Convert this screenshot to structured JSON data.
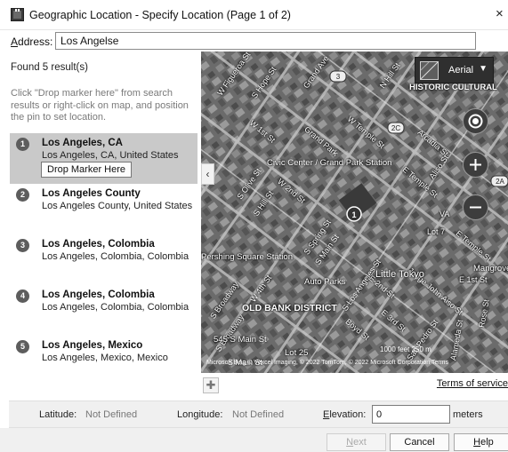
{
  "window": {
    "title": "Geographic Location - Specify Location (Page 1 of 2)",
    "close_label": "×"
  },
  "address": {
    "label_underlined": "A",
    "label_rest": "ddress:",
    "value": "Los Angelse"
  },
  "results": {
    "found_text": "Found 5 result(s)",
    "instructions": "Click \"Drop marker here\" from search results or right-click on map, and position the pin to set location.",
    "drop_marker_label": "Drop Marker Here",
    "items": [
      {
        "num": "1",
        "name": "Los Angeles, CA",
        "detail": "Los Angeles, CA, United States",
        "selected": true
      },
      {
        "num": "2",
        "name": "Los Angeles County",
        "detail": "Los Angeles County, United States"
      },
      {
        "num": "3",
        "name": "Los Angeles, Colombia",
        "detail": "Los Angeles, Colombia, Colombia"
      },
      {
        "num": "4",
        "name": "Los Angeles, Colombia",
        "detail": "Los Angeles, Colombia, Colombia"
      },
      {
        "num": "5",
        "name": "Los Angeles, Mexico",
        "detail": "Los Angeles, Mexico, Mexico"
      }
    ]
  },
  "map": {
    "style_label": "Aerial",
    "collapse_glyph": "‹",
    "scale_text": "1000 feet          250 m",
    "copyright": "Microsoft Bing   © Vexcel Imaging, © 2022 TomTom, © 2022 Microsoft Corporation  Terms",
    "pin_number": "1",
    "streets": [
      "W Figueroa St",
      "S Hope St",
      "Grand Ave",
      "W 1st St",
      "W 2nd St",
      "S Olive St",
      "S Hill St",
      "W Temple St",
      "E Temple St",
      "Arcadia St",
      "Aliso St",
      "Lot 7",
      "E Temple St",
      "E 1st St",
      "Judge John Aiso St",
      "E 2nd St",
      "W 4th St",
      "S Main St",
      "S Spring St",
      "S Broadway",
      "S Los Angeles St",
      "E 3rd St",
      "Boyd St",
      "San Pedro St",
      "Alameda St",
      "Rose St",
      "N Hill St",
      "Grand Park",
      "S Broadway",
      "S Main St",
      "VA"
    ],
    "places": [
      "Civic Center / Grand Park Station",
      "Pershing Square Station",
      "Little Tokyo",
      "Auto Parks",
      "Mangrove Lot",
      "545 S Main St",
      "Lot 25"
    ],
    "districts": [
      "OLD BANK DISTRICT",
      "HISTORIC CULTURAL"
    ],
    "route_shields": [
      "3",
      "2C",
      "2A"
    ]
  },
  "below_map": {
    "pin_glyph": "✚",
    "terms_link": "Terms of service"
  },
  "coords": {
    "latitude_label": "Latitude:",
    "latitude_value": "Not Defined",
    "longitude_label": "Longitude:",
    "longitude_value": "Not Defined",
    "elevation_label_underlined": "E",
    "elevation_label_rest": "levation:",
    "elevation_value": "0",
    "elevation_unit": "meters"
  },
  "footer": {
    "next_underlined": "N",
    "next_rest": "ext",
    "cancel_label": "Cancel",
    "help_underlined": "H",
    "help_rest": "elp"
  }
}
